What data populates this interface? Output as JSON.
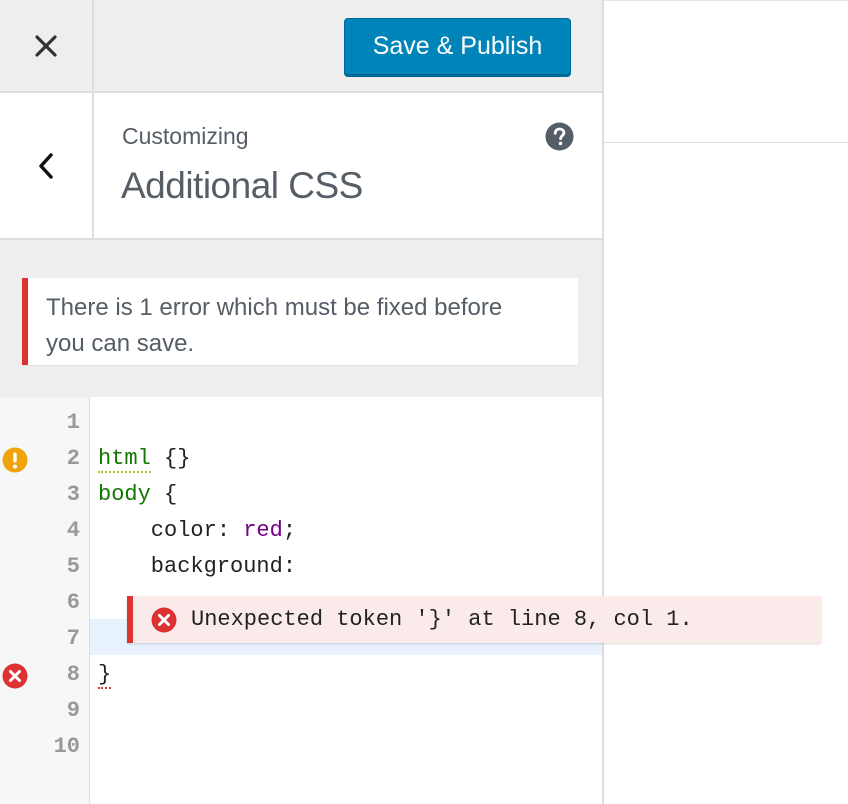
{
  "header": {
    "close_label": "×",
    "publish_label": "Save & Publish"
  },
  "section": {
    "breadcrumb": "Customizing",
    "title": "Additional CSS"
  },
  "notice": {
    "text": "There is 1 error which must be fixed before you can save."
  },
  "editor": {
    "line_numbers": [
      "1",
      "2",
      "3",
      "4",
      "5",
      "6",
      "7",
      "8",
      "9",
      "10"
    ],
    "code": {
      "l2_selector": "html",
      "l2_rest": " {}",
      "l3_selector": "body",
      "l3_rest": " {",
      "l4_prop": "    color: ",
      "l4_value": "red",
      "l4_end": ";",
      "l5": "    background:",
      "l8": "}"
    },
    "error_tooltip": "Unexpected token '}' at line 8, col 1."
  },
  "colors": {
    "primary": "#0085ba",
    "error": "#dc3232",
    "warning": "#f0a30a"
  },
  "icons": {
    "close": "close-icon",
    "back": "chevron-left-icon",
    "help": "help-icon",
    "warning": "warning-icon",
    "error": "error-icon"
  }
}
